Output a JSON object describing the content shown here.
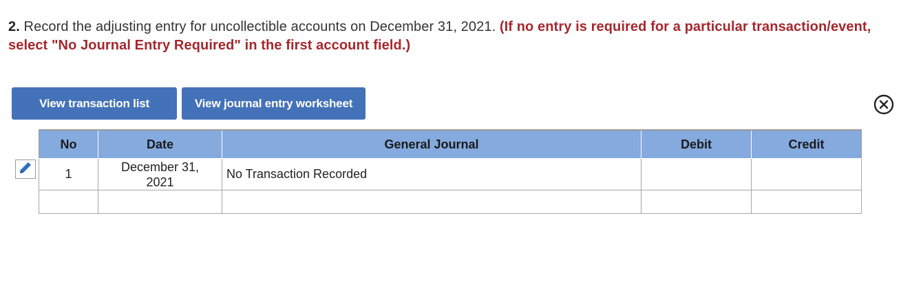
{
  "question": {
    "number": "2.",
    "text": " Record the adjusting entry for uncollectible accounts on December 31, 2021. ",
    "instruction": "(If no entry is required for a particular transaction/event, select \"No Journal Entry Required\" in the first account field.)"
  },
  "buttons": {
    "transaction_list": "View transaction list",
    "journal_worksheet": "View journal entry worksheet"
  },
  "icons": {
    "close": "close-circle-icon",
    "edit": "pencil-icon"
  },
  "colors": {
    "button": "#4472b8",
    "header": "#84aade",
    "instruction": "#a5272d"
  },
  "table": {
    "headers": {
      "no": "No",
      "date": "Date",
      "general_journal": "General Journal",
      "debit": "Debit",
      "credit": "Credit"
    },
    "rows": [
      {
        "no": "1",
        "date_line1": "December 31,",
        "date_line2": "2021",
        "general_journal": "No Transaction Recorded",
        "debit": "",
        "credit": ""
      },
      {
        "no": "",
        "date_line1": "",
        "date_line2": "",
        "general_journal": "",
        "debit": "",
        "credit": ""
      }
    ]
  }
}
